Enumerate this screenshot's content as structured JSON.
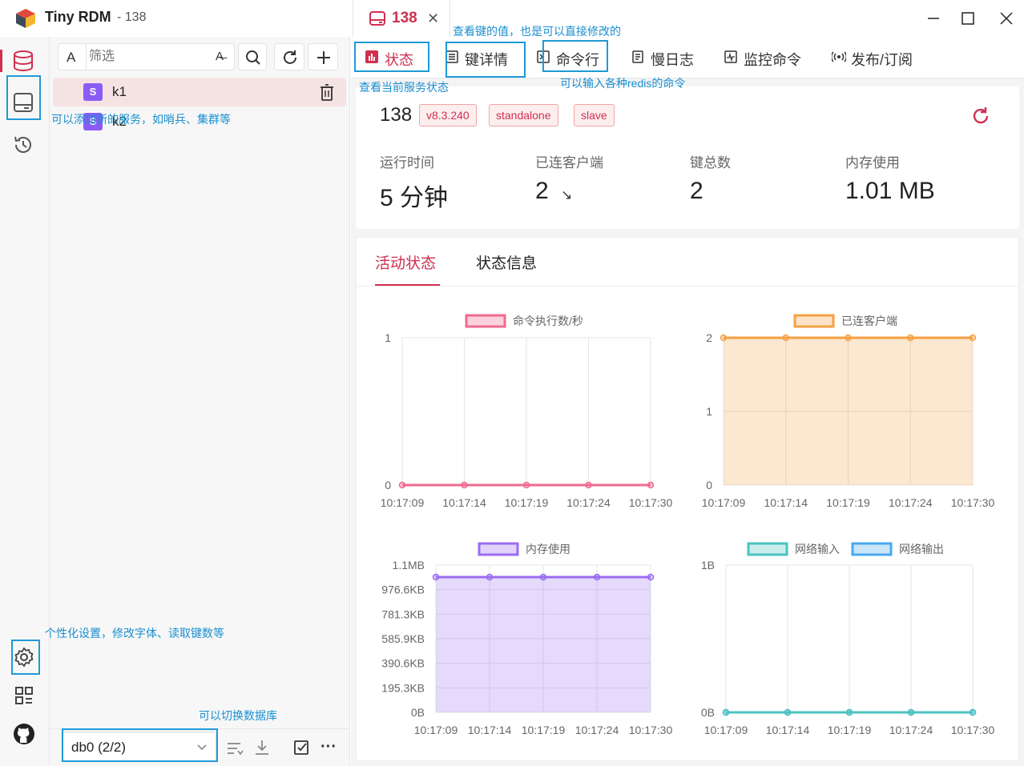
{
  "app": {
    "name": "Tiny RDM",
    "connection_suffix": "- 138",
    "tab_label": "138"
  },
  "keys_panel": {
    "filter_placeholder": "筛选",
    "type_button_label": "A",
    "keys": [
      {
        "type": "S",
        "name": "k1",
        "selected": true
      },
      {
        "type": "S",
        "name": "k2",
        "selected": false
      }
    ],
    "db_select_value": "db0 (2/2)"
  },
  "nav_tabs": [
    {
      "label": "状态",
      "icon": "status-chart-icon",
      "active": true
    },
    {
      "label": "键详情",
      "icon": "key-detail-icon",
      "active": false
    },
    {
      "label": "命令行",
      "icon": "terminal-icon",
      "active": false
    },
    {
      "label": "慢日志",
      "icon": "slowlog-icon",
      "active": false
    },
    {
      "label": "监控命令",
      "icon": "monitor-icon",
      "active": false
    },
    {
      "label": "发布/订阅",
      "icon": "pubsub-icon",
      "active": false
    }
  ],
  "server": {
    "name": "138",
    "tags": [
      "v8.3.240",
      "standalone",
      "slave"
    ],
    "stats": [
      {
        "label": "运行时间",
        "value": "5 分钟"
      },
      {
        "label": "已连客户端",
        "value": "2",
        "trend": "↘"
      },
      {
        "label": "键总数",
        "value": "2"
      },
      {
        "label": "内存使用",
        "value": "1.01 MB"
      }
    ]
  },
  "sub_tabs": [
    {
      "label": "活动状态",
      "active": true
    },
    {
      "label": "状态信息",
      "active": false
    }
  ],
  "charts": {
    "times": [
      "10:17:09",
      "10:17:14",
      "10:17:19",
      "10:17:24",
      "10:17:30"
    ],
    "cmd": {
      "legend": "命令执行数/秒",
      "yticks": [
        "1",
        "0"
      ],
      "color": "#f06a8f",
      "values": [
        0,
        0,
        0,
        0,
        0
      ],
      "ymax": 1
    },
    "clients": {
      "legend": "已连客户端",
      "yticks": [
        "2",
        "1",
        "0"
      ],
      "color": "#f5a042",
      "values": [
        2,
        2,
        2,
        2,
        2
      ],
      "ymax": 2
    },
    "memory": {
      "legend": "内存使用",
      "yticks": [
        "1.1MB",
        "976.6KB",
        "781.3KB",
        "585.9KB",
        "390.6KB",
        "195.3KB",
        "0B"
      ],
      "color": "#9b6cf2",
      "values": [
        1.01,
        1.01,
        1.01,
        1.01,
        1.01
      ],
      "ymax": 1.1
    },
    "network": {
      "legend_in": "网络输入",
      "legend_out": "网络输出",
      "yticks": [
        "1B",
        "0B"
      ],
      "color_in": "#4cc3c0",
      "color_out": "#4aa8ef",
      "values_in": [
        0,
        0,
        0,
        0,
        0
      ],
      "values_out": [
        0,
        0,
        0,
        0,
        0
      ],
      "ymax": 1
    }
  },
  "chart_data": [
    {
      "type": "line",
      "series": [
        {
          "name": "命令执行数/秒",
          "values": [
            0,
            0,
            0,
            0,
            0
          ]
        }
      ],
      "categories": [
        "10:17:09",
        "10:17:14",
        "10:17:19",
        "10:17:24",
        "10:17:30"
      ],
      "ylim": [
        0,
        1
      ]
    },
    {
      "type": "area",
      "series": [
        {
          "name": "已连客户端",
          "values": [
            2,
            2,
            2,
            2,
            2
          ]
        }
      ],
      "categories": [
        "10:17:09",
        "10:17:14",
        "10:17:19",
        "10:17:24",
        "10:17:30"
      ],
      "ylim": [
        0,
        2
      ]
    },
    {
      "type": "area",
      "series": [
        {
          "name": "内存使用",
          "values": [
            1.01,
            1.01,
            1.01,
            1.01,
            1.01
          ]
        }
      ],
      "categories": [
        "10:17:09",
        "10:17:14",
        "10:17:19",
        "10:17:24",
        "10:17:30"
      ],
      "ylabel": "",
      "ylim": [
        0,
        1.1
      ]
    },
    {
      "type": "line",
      "series": [
        {
          "name": "网络输入",
          "values": [
            0,
            0,
            0,
            0,
            0
          ]
        },
        {
          "name": "网络输出",
          "values": [
            0,
            0,
            0,
            0,
            0
          ]
        }
      ],
      "categories": [
        "10:17:09",
        "10:17:14",
        "10:17:19",
        "10:17:24",
        "10:17:30"
      ],
      "ylim": [
        0,
        1
      ]
    }
  ],
  "annotations": {
    "key_detail": "查看键的值，也是可以直接修改的",
    "status": "查看当前服务状态",
    "cli": "可以输入各种redis的命令",
    "add_server": "可以添加新的服务，如哨兵、集群等",
    "settings": "个性化设置，修改字体、读取键数等",
    "switch_db": "可以切换数据库"
  },
  "colors": {
    "accent": "#d03050",
    "annotation": "#1f9ad6"
  }
}
